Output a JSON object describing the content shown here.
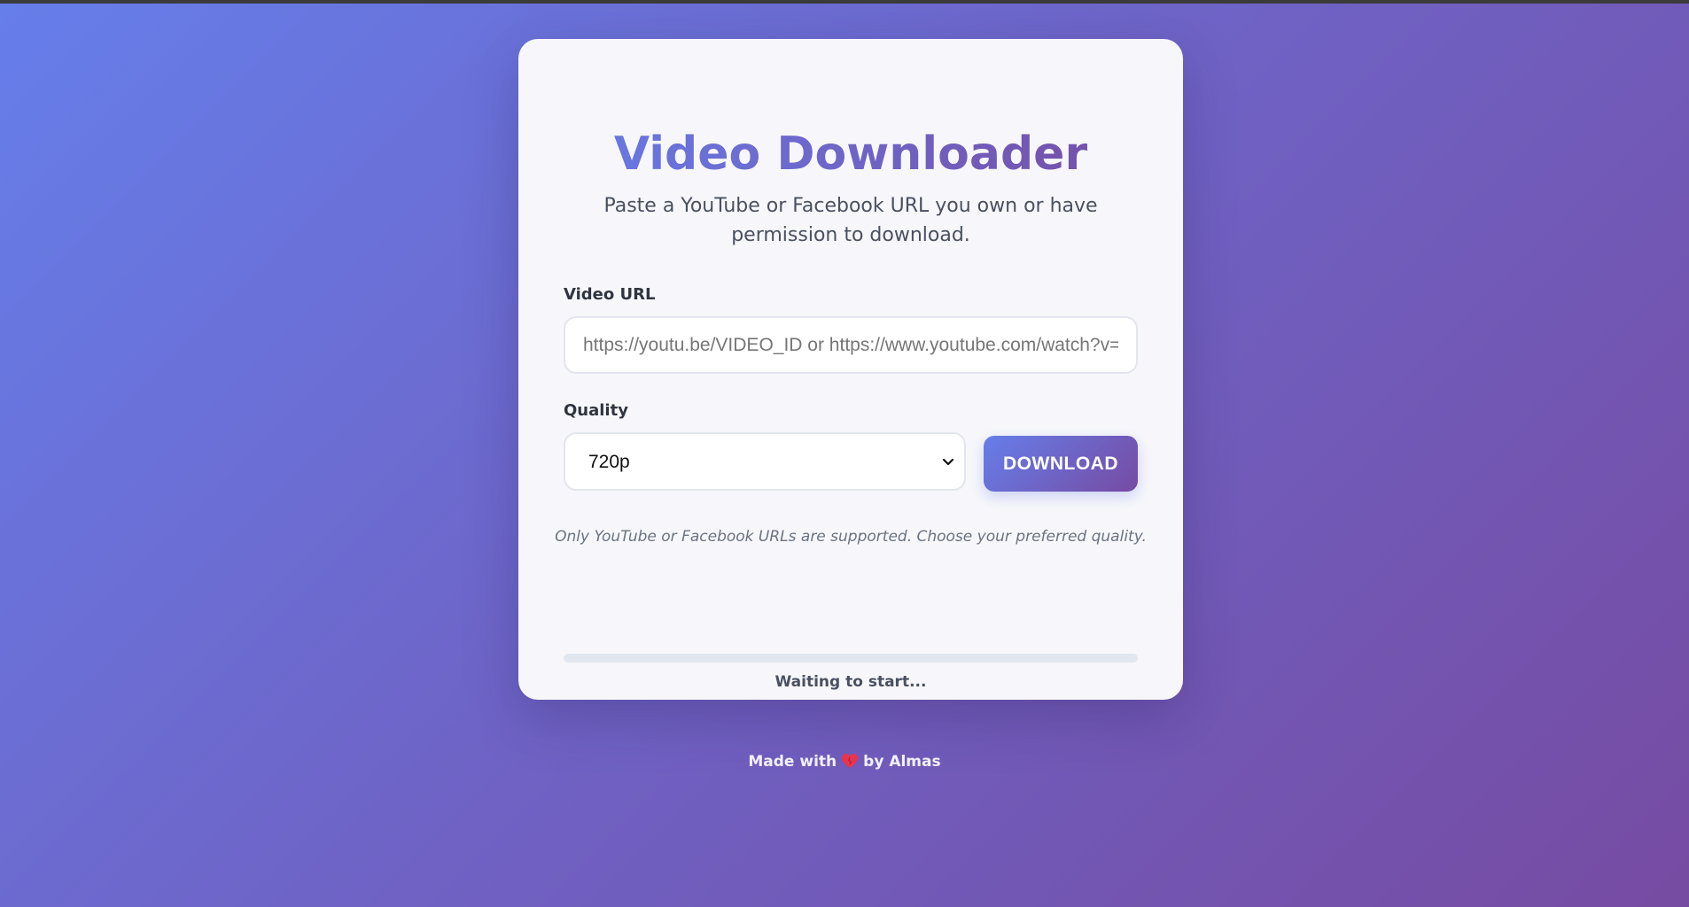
{
  "app": {
    "title": "Video Downloader",
    "subtitle": "Paste a YouTube or Facebook URL you own or have permission to download."
  },
  "form": {
    "url_label": "Video URL",
    "url_value": "",
    "url_placeholder": "https://youtu.be/VIDEO_ID or https://www.youtube.com/watch?v=VIDEO_ID",
    "quality_label": "Quality",
    "quality_selected": "720p",
    "download_label": "DOWNLOAD",
    "hint": "Only YouTube or Facebook URLs are supported. Choose your preferred quality."
  },
  "progress": {
    "percent": 0,
    "status": "Waiting to start..."
  },
  "footer": {
    "prefix": "Made with",
    "suffix": "by Almas"
  },
  "icons": {
    "select_arrow": "chevron-down-icon",
    "footer_heart": "heart-icon"
  },
  "colors": {
    "gradient_start": "#667eea",
    "gradient_end": "#764ba2",
    "card_bg": "#f7f7fb",
    "heart": "#e8344e"
  }
}
